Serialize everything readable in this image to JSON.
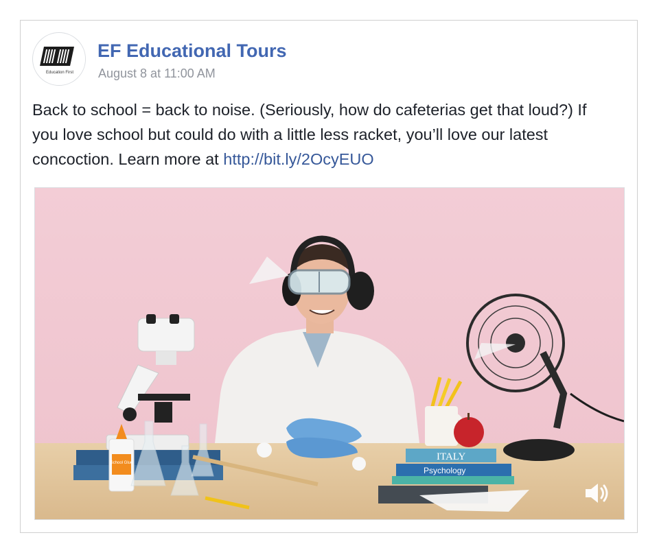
{
  "post": {
    "page_name": "EF Educational Tours",
    "timestamp": "August 8 at 11:00 AM",
    "avatar_logo_text": "EF",
    "avatar_tagline": "Education First",
    "text_before_link": "Back to school = back to noise. (Seriously, how do cafeterias get that loud?) If you love school but could do with a little less racket, you’ll love our latest concoction. Learn more at ",
    "link_text": "http://bit.ly/2OcyEUO"
  },
  "media": {
    "book_titles": [
      "ITALY",
      "Psychology"
    ],
    "glue_label": "School Glue",
    "volume_icon": "speaker-volume-icon"
  },
  "colors": {
    "link": "#4267b2",
    "timestamp": "#90949c",
    "text": "#1d2129",
    "background_pink": "#f1c9d2"
  }
}
